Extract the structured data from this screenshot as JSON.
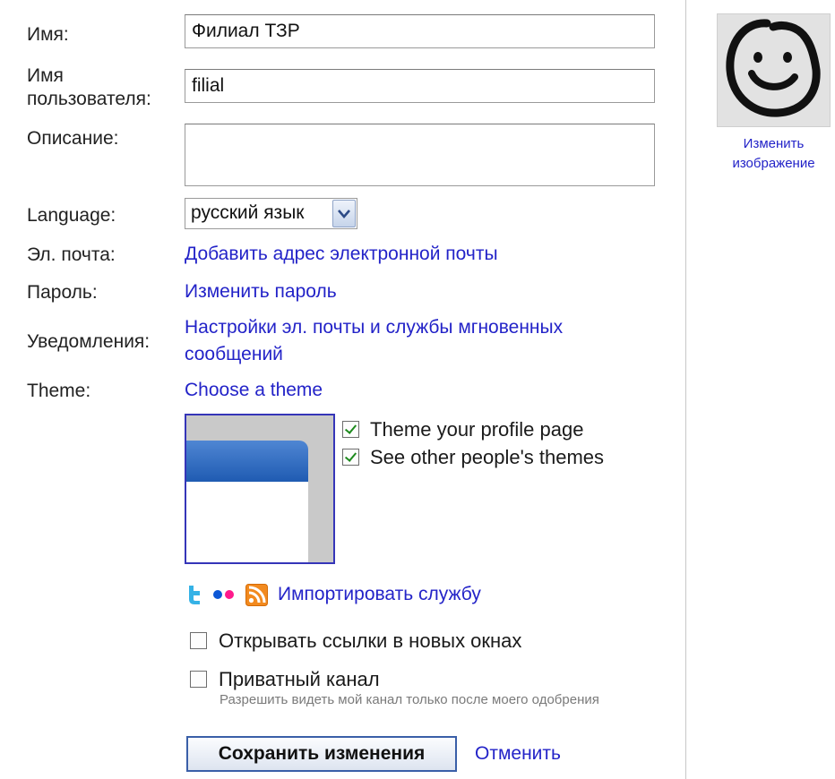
{
  "form": {
    "name_label": "Имя:",
    "name_value": "Филиал ТЗР",
    "username_label_1": "Имя",
    "username_label_2": "пользователя:",
    "username_value": "filial",
    "description_label": "Описание:",
    "description_value": "",
    "language_label": "Language:",
    "language_value": "русский язык",
    "email_label": "Эл. почта:",
    "email_link": "Добавить адрес электронной почты",
    "password_label": "Пароль:",
    "password_link": "Изменить пароль",
    "notifications_label": "Уведомления:",
    "notifications_link_1": "Настройки эл. почты и службы мгновенных",
    "notifications_link_2": "сообщений",
    "theme_label": "Theme:",
    "theme_link": "Choose a theme"
  },
  "theme_options": {
    "profile_label": "Theme your profile page",
    "profile_checked": true,
    "others_label": "See other people's themes",
    "others_checked": true
  },
  "services": {
    "icons": [
      "twitter-icon",
      "flickr-icon",
      "rss-icon"
    ],
    "import_link": "Импортировать службу"
  },
  "options": {
    "open_links_label": "Открывать ссылки в новых окнах",
    "open_links_checked": false,
    "private_label": "Приватный канал",
    "private_checked": false,
    "private_hint": "Разрешить видеть мой канал только после моего одобрения"
  },
  "actions": {
    "save_label": "Сохранить изменения",
    "cancel_label": "Отменить"
  },
  "avatar": {
    "change_link_1": "Изменить",
    "change_link_2": "изображение"
  },
  "colors": {
    "link": "#2323c8",
    "theme_header": "#2f6cc4",
    "check": "#1d8a1d"
  }
}
